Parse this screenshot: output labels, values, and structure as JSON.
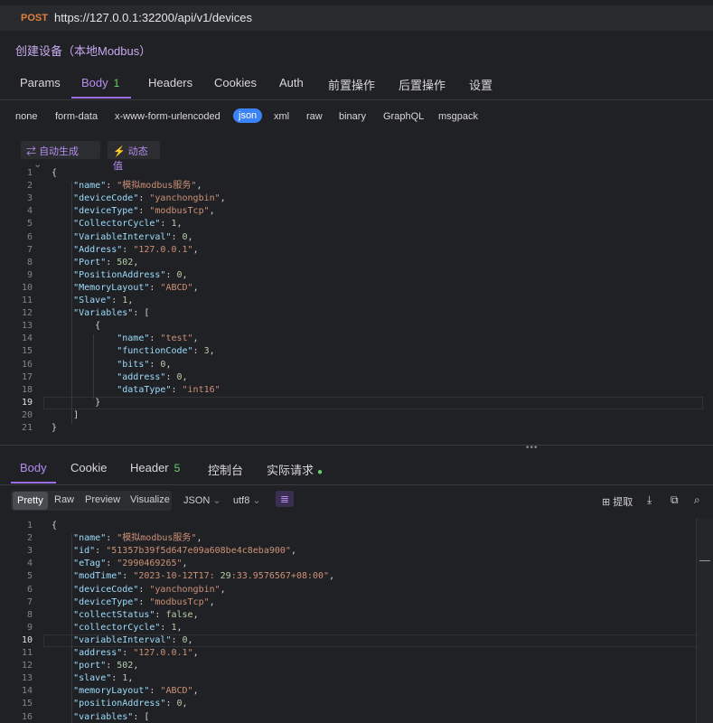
{
  "request": {
    "method": "POST",
    "url": "https://127.0.0.1:32200/api/v1/devices",
    "name": "创建设备（本地Modbus）"
  },
  "req_tabs": [
    {
      "label": "Params"
    },
    {
      "label": "Body",
      "badge": "1"
    },
    {
      "label": "Headers"
    },
    {
      "label": "Cookies"
    },
    {
      "label": "Auth"
    },
    {
      "label": "前置操作"
    },
    {
      "label": "后置操作"
    },
    {
      "label": "设置"
    }
  ],
  "content_types": [
    "none",
    "form-data",
    "x-www-form-urlencoded",
    "json",
    "xml",
    "raw",
    "binary",
    "GraphQL",
    "msgpack"
  ],
  "body_toolbar": {
    "auto_generate": "自动生成",
    "dynamic_value": "动态值"
  },
  "request_body": [
    "{",
    "    \"name\": \"模拟modbus服务\",",
    "    \"deviceCode\": \"yanchongbin\",",
    "    \"deviceType\": \"modbusTcp\",",
    "    \"CollectorCycle\": 1,",
    "    \"VariableInterval\": 0,",
    "    \"Address\": \"127.0.0.1\",",
    "    \"Port\": 502,",
    "    \"PositionAddress\": 0,",
    "    \"MemoryLayout\": \"ABCD\",",
    "    \"Slave\": 1,",
    "    \"Variables\": [",
    "        {",
    "            \"name\": \"test\",",
    "            \"functionCode\": 3,",
    "            \"bits\": 0,",
    "            \"address\": 0,",
    "            \"dataType\": \"int16\"",
    "        }",
    "    ]",
    "}"
  ],
  "resp_tabs": [
    {
      "label": "Body"
    },
    {
      "label": "Cookie"
    },
    {
      "label": "Header",
      "badge": "5"
    },
    {
      "label": "控制台"
    },
    {
      "label": "实际请求"
    }
  ],
  "resp_toolbar": {
    "views": [
      "Pretty",
      "Raw",
      "Preview",
      "Visualize"
    ],
    "format": "JSON",
    "encoding": "utf8",
    "extract": "提取"
  },
  "response_body": [
    "{",
    "    \"name\": \"模拟modbus服务\",",
    "    \"id\": \"51357b39f5d647e09a608be4c8eba900\",",
    "    \"eTag\": \"2990469265\",",
    "    \"modTime\": \"2023-10-12T17:29:33.9576567+08:00\",",
    "    \"deviceCode\": \"yanchongbin\",",
    "    \"deviceType\": \"modbusTcp\",",
    "    \"collectStatus\": false,",
    "    \"collectorCycle\": 1,",
    "    \"variableInterval\": 0,",
    "    \"address\": \"127.0.0.1\",",
    "    \"port\": 502,",
    "    \"slave\": 1,",
    "    \"memoryLayout\": \"ABCD\",",
    "    \"positionAddress\": 0,",
    "    \"variables\": ["
  ],
  "colors": {
    "accent": "#9b6ef0",
    "method": "#e0813d",
    "json_active": "#3b82f6",
    "badge": "#6ccf6c"
  }
}
